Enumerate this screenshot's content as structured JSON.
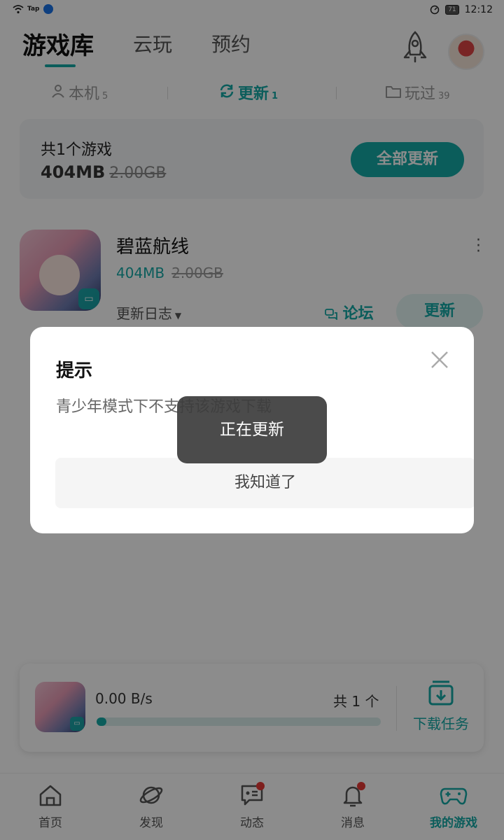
{
  "status_bar": {
    "tap_label": "Tap",
    "battery": "71",
    "time": "12:12"
  },
  "header": {
    "tabs": [
      {
        "label": "游戏库",
        "active": true
      },
      {
        "label": "云玩",
        "active": false
      },
      {
        "label": "预约",
        "active": false
      }
    ],
    "icons": [
      "rocket-icon",
      "avatar"
    ]
  },
  "subtabs": [
    {
      "label": "本机",
      "count": "5",
      "icon": "device-icon",
      "active": false
    },
    {
      "label": "更新",
      "count": "1",
      "icon": "refresh-icon",
      "active": true
    },
    {
      "label": "玩过",
      "count": "39",
      "icon": "folder-icon",
      "active": false
    }
  ],
  "summary": {
    "count_text": "共1个游戏",
    "size": "404MB",
    "original_size": "2.00GB",
    "update_all_label": "全部更新"
  },
  "game": {
    "name": "碧蓝航线",
    "size": "404MB",
    "original_size": "2.00GB",
    "changelog_label": "更新日志",
    "forum_label": "论坛",
    "update_label": "更新"
  },
  "download": {
    "speed": "0.00 B/s",
    "total": "共 1 个",
    "progress": 0.0,
    "task_label": "下载任务"
  },
  "bottom_nav": [
    {
      "label": "首页",
      "icon": "home-icon",
      "badge": false,
      "active": false
    },
    {
      "label": "发现",
      "icon": "planet-icon",
      "badge": false,
      "active": false
    },
    {
      "label": "动态",
      "icon": "chat-icon",
      "badge": true,
      "active": false
    },
    {
      "label": "消息",
      "icon": "bell-icon",
      "badge": true,
      "active": false
    },
    {
      "label": "我的游戏",
      "icon": "gamepad-icon",
      "badge": false,
      "active": true
    }
  ],
  "dialog": {
    "title": "提示",
    "message": "青少年模式下不支持该游戏下载",
    "ok_label": "我知道了"
  },
  "toast": {
    "text": "正在更新"
  },
  "colors": {
    "accent": "#14a9a7",
    "badge": "#e53935"
  }
}
